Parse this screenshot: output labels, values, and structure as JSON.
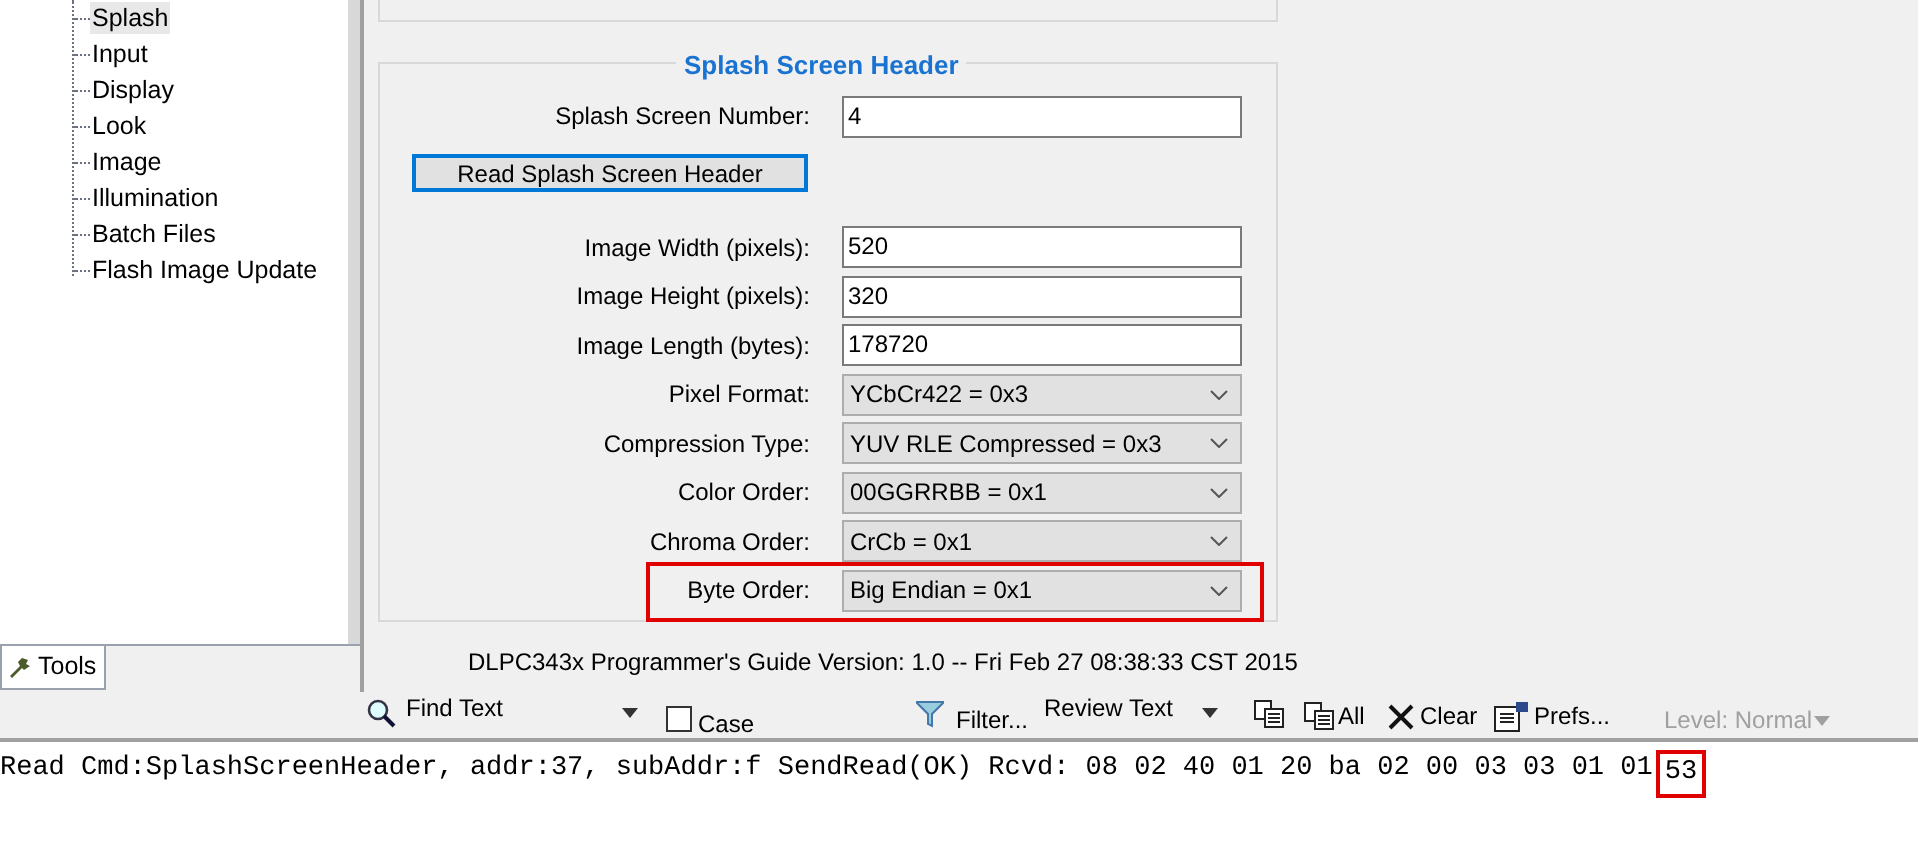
{
  "tree": {
    "items": [
      {
        "label": "Splash",
        "selected": true
      },
      {
        "label": "Input",
        "selected": false
      },
      {
        "label": "Display",
        "selected": false
      },
      {
        "label": "Look",
        "selected": false
      },
      {
        "label": "Image",
        "selected": false
      },
      {
        "label": "Illumination",
        "selected": false
      },
      {
        "label": "Batch Files",
        "selected": false
      },
      {
        "label": "Flash Image Update",
        "selected": false
      }
    ]
  },
  "bottom_tab": {
    "label": "Tools"
  },
  "group": {
    "title": "Splash Screen Header",
    "rows": [
      {
        "kind": "input",
        "label": "Splash Screen Number:",
        "value": "4"
      },
      {
        "kind": "button",
        "label": "Read Splash Screen Header"
      },
      {
        "kind": "input",
        "label": "Image Width (pixels):",
        "value": "520"
      },
      {
        "kind": "input",
        "label": "Image Height (pixels):",
        "value": "320"
      },
      {
        "kind": "input",
        "label": "Image Length (bytes):",
        "value": "178720"
      },
      {
        "kind": "combo",
        "label": "Pixel Format:",
        "value": "YCbCr422 = 0x3",
        "highlighted": false
      },
      {
        "kind": "combo",
        "label": "Compression Type:",
        "value": "YUV RLE Compressed = 0x3",
        "highlighted": false
      },
      {
        "kind": "combo",
        "label": "Color Order:",
        "value": "00GGRRBB = 0x1",
        "highlighted": false
      },
      {
        "kind": "combo",
        "label": "Chroma Order:",
        "value": "CrCb = 0x1",
        "highlighted": false
      },
      {
        "kind": "combo",
        "label": "Byte Order:",
        "value": "Big Endian = 0x1",
        "highlighted": true
      }
    ]
  },
  "version": "DLPC343x Programmer's Guide Version: 1.0 -- Fri Feb 27 08:38:33 CST 2015",
  "toolbar": {
    "find": "Find Text",
    "case": {
      "label": "Case",
      "checked": false
    },
    "filter": "Filter...",
    "review": "Review Text",
    "copy_all": "All",
    "clear": "Clear",
    "prefs": "Prefs...",
    "level": {
      "label": "Level: Normal",
      "disabled": true
    }
  },
  "log": {
    "text": "Read Cmd:SplashScreenHeader, addr:37, subAddr:f SendRead(OK) Rcvd: 08 02 40 01 20 ba 02 00 03 03 01 01",
    "highlighted_text": "53"
  }
}
